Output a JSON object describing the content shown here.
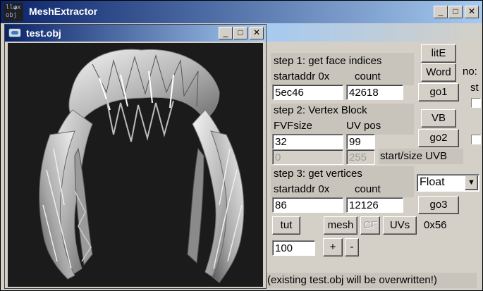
{
  "app": {
    "title": "MeshExtractor",
    "icon_text": "ll◕x\nobj"
  },
  "child": {
    "title": "test.obj"
  },
  "step1": {
    "title": "step 1: get face indices",
    "startaddr_label": "startaddr 0x",
    "count_label": "count",
    "startaddr_value": "5ec46",
    "count_value": "42618",
    "lite_button": "litE",
    "word_button": "Word",
    "go_button": "go1"
  },
  "step2": {
    "title": "step 2: Vertex Block",
    "fvf_label": "FVFsize",
    "uvpos_label": "UV pos",
    "fvf_value": "32",
    "uvpos_value": "99",
    "uv_start_value": "0",
    "uv_size_value": "255",
    "uvb_label": "start/size UVB",
    "vb_button": "VB",
    "go_button": "go2"
  },
  "step3": {
    "title": "step 3: get vertices",
    "startaddr_label": "startaddr 0x",
    "count_label": "count",
    "startaddr_value": "86",
    "count_value": "12126",
    "format_select": "Float",
    "go_button": "go3"
  },
  "bottom": {
    "tut_button": "tut",
    "mesh_button": "mesh",
    "cf_button": "CF",
    "uvs_button": "UVs",
    "hex_label": "0x56",
    "scale_value": "100",
    "plus_button": "+",
    "minus_button": "-",
    "warning": "(existing test.obj will be overwritten!)"
  },
  "cut_off": {
    "no_label": "no:",
    "st_label": "st"
  }
}
